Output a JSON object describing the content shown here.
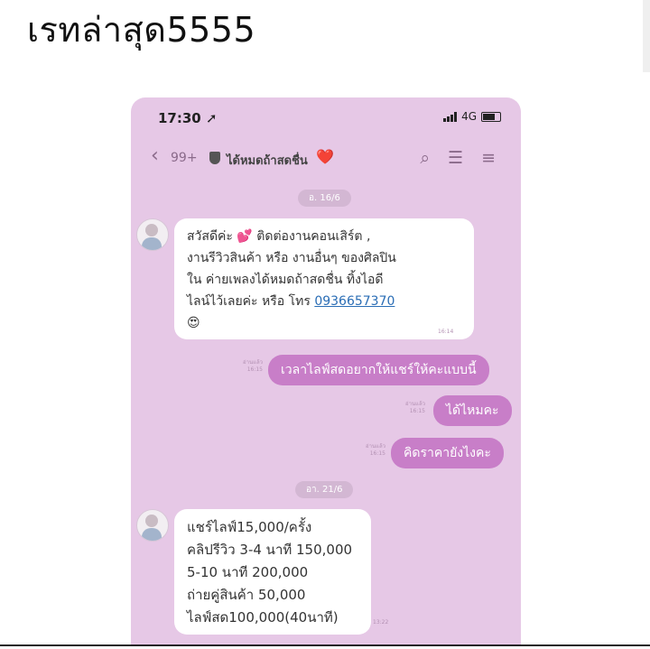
{
  "post": {
    "title": "เรทล่าสุด5555"
  },
  "status": {
    "time": "17:30",
    "network": "4G"
  },
  "nav": {
    "back_count": "99+",
    "chat_name": "ได้หมดถ้าสดชื่น",
    "heart": "❤️"
  },
  "messages": {
    "date1": "อ. 16/6",
    "m1_line1": "สวัสดีค่ะ 💕 ติดต่องานคอนเสิร์ต ,",
    "m1_line2": "งานรีวิวสินค้า หรือ งานอื่นๆ ของศิลปิน",
    "m1_line3": "ใน ค่ายเพลงได้หมดถ้าสดชื่น ทิ้งไอดี",
    "m1_line4": "ไลน์ไว้เลยค่ะ หรือ โทร",
    "m1_phone": "0936657370",
    "m1_emoji": "😍",
    "m1_time": "16:14",
    "m2": "เวลาไลฟ์สดอยากให้แชร์ให้คะแบบนี้",
    "m2_read": "อ่านแล้ว",
    "m2_time": "16:15",
    "m3": "ได้ไหมคะ",
    "m3_read": "อ่านแล้ว",
    "m3_time": "16:15",
    "m4": "คิดราคายังไงคะ",
    "m4_read": "อ่านแล้ว",
    "m4_time": "16:15",
    "date2": "อา. 21/6",
    "m5_line1": "แชร์ไลฟ์15,000/ครั้ง",
    "m5_line2": "คลิปรีวิว 3-4 นาที 150,000",
    "m5_line3": "5-10 นาที 200,000",
    "m5_line4": "ถ่ายคู่สินค้า 50,000",
    "m5_line5": "ไลฟ์สด100,000(40นาที)",
    "m5_time": "13:22"
  }
}
